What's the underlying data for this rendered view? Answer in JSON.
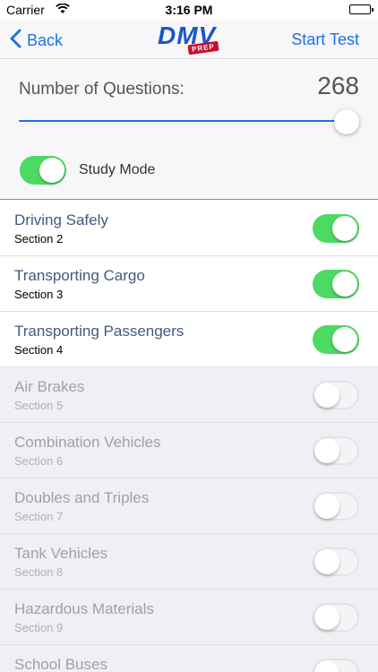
{
  "status_bar": {
    "carrier": "Carrier",
    "time": "3:16 PM"
  },
  "nav": {
    "back_label": "Back",
    "logo_text": "DMV",
    "logo_badge": "PREP",
    "start_label": "Start Test"
  },
  "settings": {
    "questions_label": "Number of Questions:",
    "questions_value": "268",
    "slider_fraction": 1.0,
    "study_mode_label": "Study Mode",
    "study_mode_on": true
  },
  "sections": [
    {
      "title": "Driving Safely",
      "subtitle": "Section 2",
      "enabled": true
    },
    {
      "title": "Transporting Cargo",
      "subtitle": "Section 3",
      "enabled": true
    },
    {
      "title": "Transporting Passengers",
      "subtitle": "Section 4",
      "enabled": true
    },
    {
      "title": "Air Brakes",
      "subtitle": "Section 5",
      "enabled": false
    },
    {
      "title": "Combination Vehicles",
      "subtitle": "Section 6",
      "enabled": false
    },
    {
      "title": "Doubles and Triples",
      "subtitle": "Section 7",
      "enabled": false
    },
    {
      "title": "Tank Vehicles",
      "subtitle": "Section 8",
      "enabled": false
    },
    {
      "title": "Hazardous Materials",
      "subtitle": "Section 9",
      "enabled": false
    },
    {
      "title": "School Buses",
      "subtitle": "",
      "enabled": false
    }
  ],
  "colors": {
    "accent": "#1a73e8",
    "switch_on": "#4cd964",
    "logo_blue": "#1b56c7",
    "logo_red": "#c8102e"
  }
}
